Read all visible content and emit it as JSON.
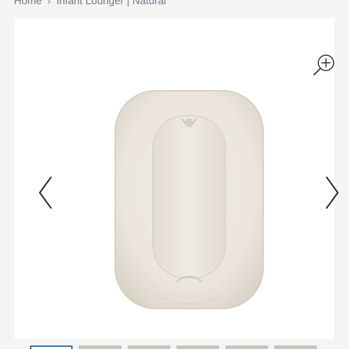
{
  "breadcrumb": {
    "home": "Home",
    "separator": "›",
    "current": "Infant Lounger | Natural"
  },
  "gallery": {
    "zoom_icon": "zoom-in-icon",
    "prev_icon": "chevron-left-icon",
    "next_icon": "chevron-right-icon",
    "product_image": "infant-lounger-natural",
    "thumbnail_count": 6,
    "active_thumbnail": 1
  },
  "colors": {
    "page_background": "#f4f4f4",
    "breadcrumb_text": "#6c7a8c",
    "active_thumbnail_border": "#3a6c9a",
    "lounger": "#ece7df"
  }
}
